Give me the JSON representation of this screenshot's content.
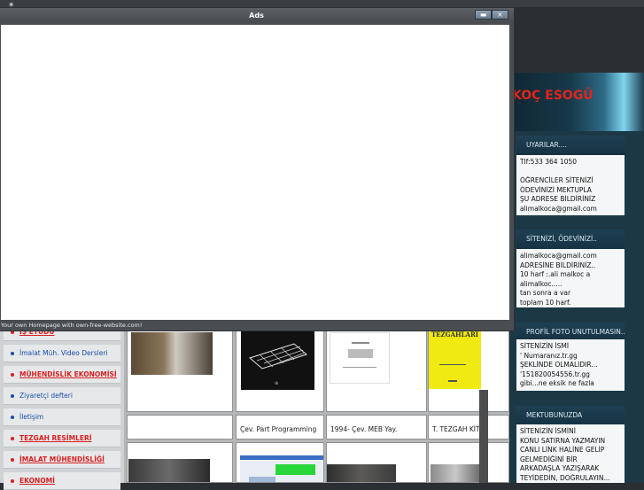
{
  "ads_window": {
    "title": "Ads",
    "footer": "Your own Homepage with own-free-website.com!",
    "minimize": "▬",
    "close": "×"
  },
  "site": {
    "logo": "KOÇ ESOGÜ"
  },
  "sidebar_right": {
    "sections": [
      {
        "title": "UYARILAR....",
        "lines": [
          "Tlf:533 364 1050",
          "",
          "ÖĞRENCİLER SİTENİZİ",
          "ÖDEVİNİZİ MEKTUPLA",
          "ŞU ADRESE BİLDİRİNİZ",
          "alimalkoca@gmail.com"
        ]
      },
      {
        "title": "SİTENİZİ, ÖDEVİNİZİ..",
        "lines": [
          "alimalkoca@gmail.com",
          "ADRESİNE BİLDİRİNİZ..",
          "10 harf :.ali malkoc a",
          "alimalkoc.....",
          "tan sonra a var",
          "toplam 10 harf."
        ]
      },
      {
        "title": "PROFİL FOTO UNUTULMASIN..",
        "lines": [
          "SİTENİZİN İSMİ",
          "' Numaranız.tr.gg",
          "ŞEKLİNDE OLMALIDIR...",
          "'151820054556.tr.gg",
          "gibi...ne eksik ne fazla"
        ]
      },
      {
        "title": "MEKTUBUNUZDA",
        "lines": [
          "SİTENİZİN İSMİNİ",
          "KONU SATIRNA YAZMAYIN",
          "CANLI LİNK HALİNE GELİP",
          "GELMEDİĞİNİ BİR",
          "ARKADAŞLA YAZIŞARAK",
          "TEYİDEDİN, DOĞRULAYIN..."
        ]
      }
    ]
  },
  "nav": {
    "items": [
      {
        "label": "İŞ ETÜDÜ",
        "red": true
      },
      {
        "label": "İmalat Müh. Video Dersleri",
        "red": false
      },
      {
        "label": "MÜHENDİSLİK EKONOMİSİ",
        "red": true
      },
      {
        "label": "Ziyaretçi defteri",
        "red": false
      },
      {
        "label": "İletişim",
        "red": false
      },
      {
        "label": "TEZGAH RESİMLERİ",
        "red": true
      },
      {
        "label": "İMALAT MÜHENDİSLİĞİ",
        "red": true
      },
      {
        "label": "EKONOMİ",
        "red": true
      }
    ]
  },
  "grid": {
    "captions": [
      "",
      "Çev. Part Programming",
      "1994- Çev. MEB Yay.",
      "T. TEZGAH  KİTA"
    ],
    "book_title": "TEZGAHLARI"
  }
}
